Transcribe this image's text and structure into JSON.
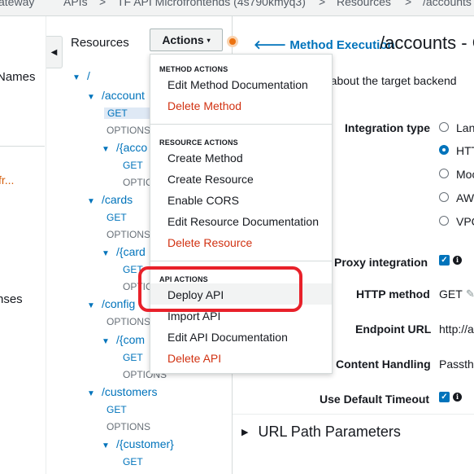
{
  "breadcrumb": {
    "items": [
      "ateway",
      "APIs",
      ">",
      "TF API Microfrontends (4s790kmyq3)",
      ">",
      "Resources",
      ">",
      "/accounts"
    ]
  },
  "left_nav": {
    "names_text": "Names",
    "fr_text": "fr...",
    "nses_text": "nses"
  },
  "collapse_icon": "◀",
  "resources": {
    "title": "Resources",
    "tree": [
      {
        "kind": "node",
        "label": "/",
        "caret": "▼"
      },
      {
        "kind": "node",
        "label": "/account",
        "caret": "▼"
      },
      {
        "kind": "method",
        "label": "GET",
        "selected": true
      },
      {
        "kind": "method",
        "label": "OPTIONS"
      },
      {
        "kind": "node",
        "label": "/{acco",
        "caret": "▼"
      },
      {
        "kind": "method",
        "label": "GET"
      },
      {
        "kind": "method",
        "label": "OPTION"
      },
      {
        "kind": "node",
        "label": "/cards",
        "caret": "▼"
      },
      {
        "kind": "method",
        "label": "GET"
      },
      {
        "kind": "method",
        "label": "OPTIONS"
      },
      {
        "kind": "node",
        "label": "/{card",
        "caret": "▼"
      },
      {
        "kind": "method",
        "label": "GET"
      },
      {
        "kind": "method",
        "label": "OPTION"
      },
      {
        "kind": "node",
        "label": "/config",
        "caret": "▼"
      },
      {
        "kind": "method",
        "label": "OPTIONS"
      },
      {
        "kind": "node",
        "label": "/{com",
        "caret": "▼"
      },
      {
        "kind": "method",
        "label": "GET"
      },
      {
        "kind": "method",
        "label": "OPTIONS"
      },
      {
        "kind": "node",
        "label": "/customers",
        "caret": "▼"
      },
      {
        "kind": "method",
        "label": "GET"
      },
      {
        "kind": "method",
        "label": "OPTIONS"
      },
      {
        "kind": "node",
        "label": "/{customer}",
        "caret": "▼"
      },
      {
        "kind": "method",
        "label": "GET"
      }
    ]
  },
  "actions": {
    "button_label": "Actions",
    "caret": "▾",
    "sections": [
      {
        "heading": "METHOD ACTIONS",
        "items": [
          {
            "label": "Edit Method Documentation",
            "danger": false
          },
          {
            "label": "Delete Method",
            "danger": true
          }
        ]
      },
      {
        "heading": "RESOURCE ACTIONS",
        "items": [
          {
            "label": "Create Method",
            "danger": false
          },
          {
            "label": "Create Resource",
            "danger": false
          },
          {
            "label": "Enable CORS",
            "danger": false
          },
          {
            "label": "Edit Resource Documentation",
            "danger": false
          },
          {
            "label": "Delete Resource",
            "danger": true
          }
        ]
      },
      {
        "heading": "API ACTIONS",
        "items": [
          {
            "label": "Deploy API",
            "danger": false,
            "highlighted": true
          },
          {
            "label": "Import API",
            "danger": false
          },
          {
            "label": "Edit API Documentation",
            "danger": false
          },
          {
            "label": "Delete API",
            "danger": true
          }
        ]
      }
    ]
  },
  "method_execution": {
    "back_arrow": "🡐",
    "back_label": "Method Execution",
    "title": "/accounts - G",
    "description": "n about the target backend",
    "integration_type_label": "Integration type",
    "integration_options": [
      {
        "label": "Lan",
        "selected": false
      },
      {
        "label": "HTT",
        "selected": true
      },
      {
        "label": "Moc",
        "selected": false
      },
      {
        "label": "AW",
        "selected": false
      },
      {
        "label": "VPC",
        "selected": false
      }
    ],
    "proxy_label": "P Proxy integration",
    "http_method_label": "HTTP method",
    "http_method_value": "GET",
    "endpoint_label": "Endpoint URL",
    "endpoint_value": "http://a",
    "content_handling_label": "Content Handling",
    "content_handling_value": "Passth",
    "default_timeout_label": "Use Default Timeout",
    "url_path_params": "URL Path Parameters",
    "url_path_caret": "▶"
  },
  "colors": {
    "accent": "#0073bb",
    "danger": "#d13212",
    "callout": "#e8212a",
    "orange": "#ec7211"
  }
}
